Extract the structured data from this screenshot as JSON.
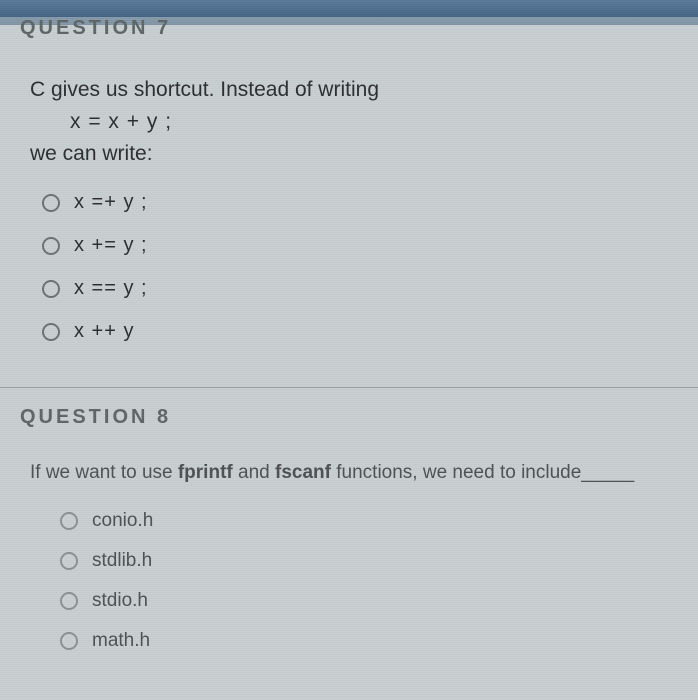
{
  "q7": {
    "header": "QUESTION 7",
    "line1": "C gives us shortcut. Instead of writing",
    "code": "x = x + y ;",
    "line2": "we can write:",
    "options": [
      "x =+ y ;",
      "x += y ;",
      "x == y ;",
      "x ++ y"
    ]
  },
  "q8": {
    "header": "QUESTION 8",
    "prompt_pre": "If we want to use ",
    "bold1": "fprintf",
    "mid": " and ",
    "bold2": "fscanf",
    "prompt_post": " functions, we need to include_____",
    "options": [
      "conio.h",
      "stdlib.h",
      "stdio.h",
      "math.h"
    ]
  }
}
